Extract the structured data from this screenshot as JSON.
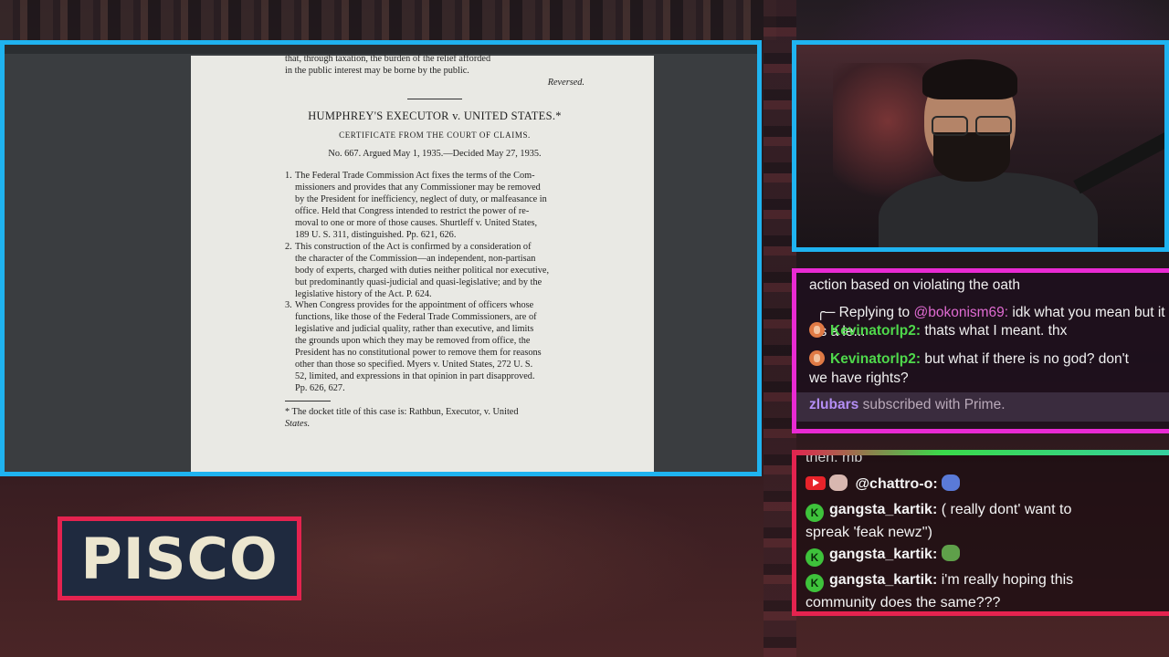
{
  "colors": {
    "doc_border": "#1fb3f0",
    "chat1_border": "#e92ad3",
    "chat2_border": "#e4234f",
    "brand_border": "#e4234f",
    "username_green": "#4fd84b"
  },
  "document": {
    "top_lines": [
      "that, through taxation, the burden of the relief afforded",
      "in the public interest may be borne by the public."
    ],
    "reversed": "Reversed.",
    "title": "HUMPHREY'S EXECUTOR v. UNITED STATES.*",
    "certificate": "CERTIFICATE FROM THE COURT OF CLAIMS.",
    "argued": "No. 667. Argued May 1, 1935.—Decided May 27, 1935.",
    "headnotes": [
      {
        "num": "1.",
        "lines": [
          "The Federal Trade Commission Act fixes the terms of the Com-",
          "missioners and provides that any Commissioner may be removed",
          "by the President for inefficiency, neglect of duty, or malfeasance in",
          "office. Held that Congress intended to restrict the power of re-",
          "moval to one or more of those causes. Shurtleff v. United States,",
          "189 U. S. 311, distinguished. Pp. 621, 626."
        ]
      },
      {
        "num": "2.",
        "lines": [
          "This construction of the Act is confirmed by a consideration of",
          "the character of the Commission—an independent, non-partisan",
          "body of experts, charged with duties neither political nor executive,",
          "but predominantly quasi-judicial and quasi-legislative; and by the",
          "legislative history of the Act. P. 624."
        ]
      },
      {
        "num": "3.",
        "lines": [
          "When Congress provides for the appointment of officers whose",
          "functions, like those of the Federal Trade Commissioners, are of",
          "legislative and judicial quality, rather than executive, and limits",
          "the grounds upon which they may be removed from office, the",
          "President has no constitutional power to remove them for reasons",
          "other than those so specified. Myers v. United States, 272 U. S.",
          "52, limited, and expressions in that opinion in part disapproved.",
          "Pp. 626, 627."
        ]
      }
    ],
    "footnote": [
      "* The docket title of this case is: Rathbun, Executor, v. United",
      "States."
    ]
  },
  "chat_top": {
    "partial_message": "action based on violating the oath",
    "reply_prefix": "Replying to",
    "reply_handle": "@bokonism69:",
    "reply_text": "idk what you mean but it is a le...",
    "messages": [
      {
        "user": "Kevinatorlp2:",
        "text": "thats what I meant. thx"
      },
      {
        "user": "Kevinatorlp2:",
        "text": "but what if there is no god? don't",
        "text2": "we have rights?"
      }
    ],
    "subscription": {
      "user": "zlubars",
      "text": "subscribed with Prime."
    }
  },
  "chat_bottom": {
    "cut_text": "then. mb",
    "mention": "@chattro-o:",
    "badge_letter": "K",
    "messages": [
      {
        "user": "gangsta_kartik:",
        "text": "( really dont' want to",
        "text2": "spreak 'feak newz'')"
      },
      {
        "user": "gangsta_kartik:",
        "text": ""
      },
      {
        "user": "gangsta_kartik:",
        "text": "i'm really hoping this",
        "text2": "community does the same???"
      }
    ]
  },
  "brand": {
    "name": "PISCO"
  }
}
